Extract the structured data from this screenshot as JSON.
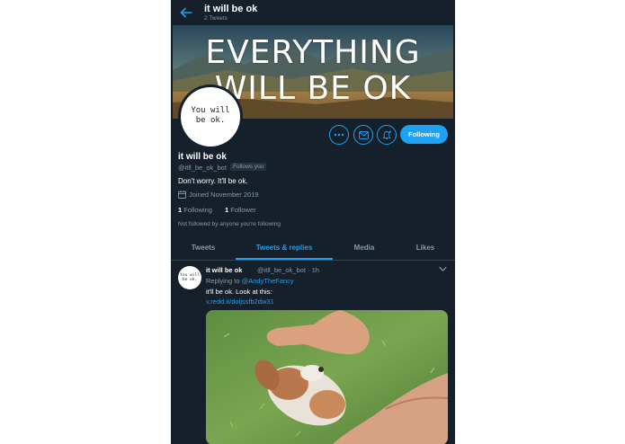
{
  "header": {
    "title": "it will be ok",
    "tweet_count": "2 Tweets"
  },
  "banner": {
    "line1": "EVERYTHING",
    "line2": "WILL BE OK"
  },
  "avatar": {
    "line1": "You will",
    "line2": "be ok."
  },
  "actions": {
    "follow_label": "Following"
  },
  "profile": {
    "name": "it will be ok",
    "handle": "@itll_be_ok_bot",
    "follows_you": "Follows you",
    "bio": "Don't worry. It'll be ok.",
    "joined": "Joined November 2019",
    "following_count": "1",
    "following_label": "Following",
    "followers_count": "1",
    "followers_label": "Follower",
    "not_followed": "Not followed by anyone you're following"
  },
  "tabs": [
    {
      "label": "Tweets"
    },
    {
      "label": "Tweets & replies"
    },
    {
      "label": "Media"
    },
    {
      "label": "Likes"
    }
  ],
  "tweet": {
    "name": "it will be ok",
    "meta": "@itll_be_ok_bot · 1h",
    "replying_to_prefix": "Replying to",
    "replying_to_user": "@AndyTheFancy",
    "text": "it'll be ok. Look at this:",
    "link": "v.redd.it/doijssfb2dw31",
    "avatar_line1": "You will",
    "avatar_line2": "be ok."
  },
  "colors": {
    "background": "#15202b",
    "accent": "#1da1f2",
    "muted": "#8899a6",
    "border": "#38444d"
  }
}
